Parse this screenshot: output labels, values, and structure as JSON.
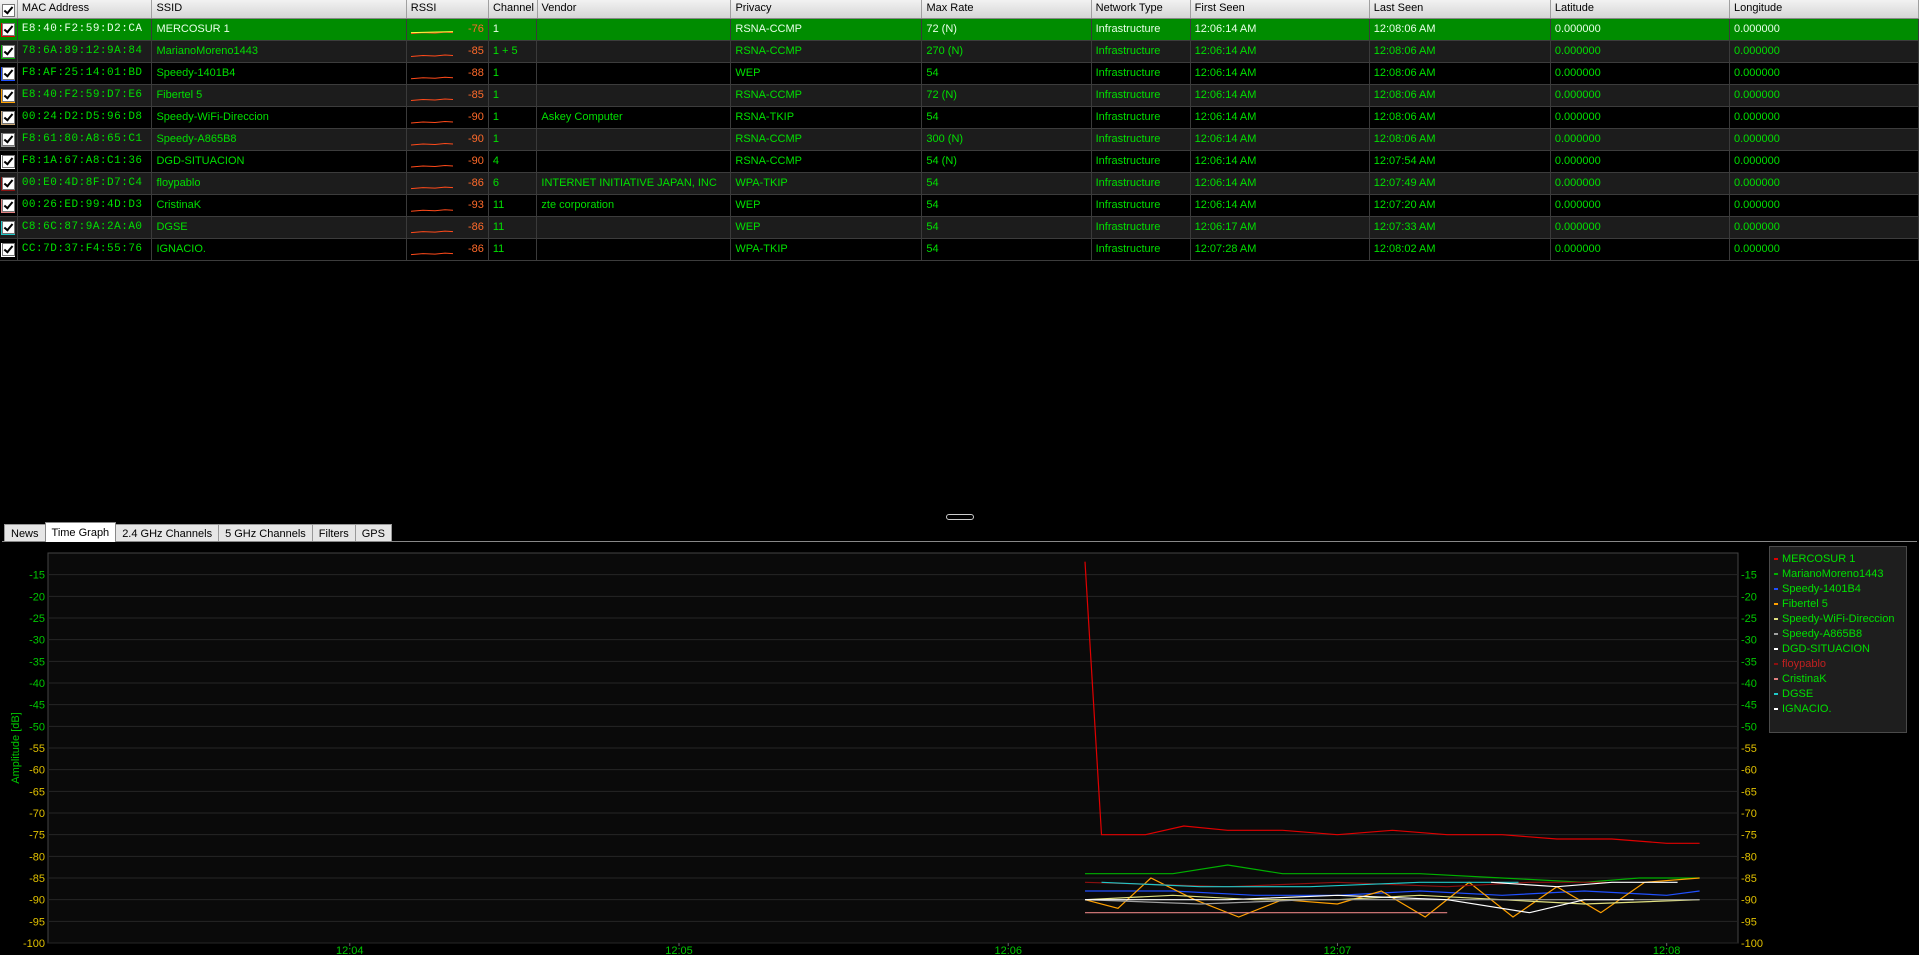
{
  "table": {
    "columns": [
      "MAC Address",
      "SSID",
      "RSSI",
      "Channel",
      "Vendor",
      "Privacy",
      "Max Rate",
      "Network Type",
      "First Seen",
      "Last Seen",
      "Latitude",
      "Longitude"
    ],
    "rows": [
      {
        "color": "#e00000",
        "mac": "E8:40:F2:59:D2:CA",
        "ssid": "MERCOSUR 1",
        "rssi": "-76",
        "channel": "1",
        "vendor": "",
        "privacy": "RSNA-CCMP",
        "max_rate": "72 (N)",
        "network_type": "Infrastructure",
        "first_seen": "12:06:14 AM",
        "last_seen": "12:08:06 AM",
        "latitude": "0.000000",
        "longitude": "0.000000",
        "selected": true
      },
      {
        "color": "#00b000",
        "mac": "78:6A:89:12:9A:84",
        "ssid": "MarianoMoreno1443",
        "rssi": "-85",
        "channel": "1 + 5",
        "vendor": "",
        "privacy": "RSNA-CCMP",
        "max_rate": "270 (N)",
        "network_type": "Infrastructure",
        "first_seen": "12:06:14 AM",
        "last_seen": "12:08:06 AM",
        "latitude": "0.000000",
        "longitude": "0.000000"
      },
      {
        "color": "#2050ff",
        "mac": "F8:AF:25:14:01:BD",
        "ssid": "Speedy-1401B4",
        "rssi": "-88",
        "channel": "1",
        "vendor": "",
        "privacy": "WEP",
        "max_rate": "54",
        "network_type": "Infrastructure",
        "first_seen": "12:06:14 AM",
        "last_seen": "12:08:06 AM",
        "latitude": "0.000000",
        "longitude": "0.000000"
      },
      {
        "color": "#ffa000",
        "mac": "E8:40:F2:59:D7:E6",
        "ssid": "Fibertel 5",
        "rssi": "-85",
        "channel": "1",
        "vendor": "",
        "privacy": "RSNA-CCMP",
        "max_rate": "72 (N)",
        "network_type": "Infrastructure",
        "first_seen": "12:06:14 AM",
        "last_seen": "12:08:06 AM",
        "latitude": "0.000000",
        "longitude": "0.000000"
      },
      {
        "color": "#c8a878",
        "mac": "00:24:D2:D5:96:D8",
        "ssid": "Speedy-WiFi-Direccion",
        "rssi": "-90",
        "channel": "1",
        "vendor": "Askey Computer",
        "privacy": "RSNA-TKIP",
        "max_rate": "54",
        "network_type": "Infrastructure",
        "first_seen": "12:06:14 AM",
        "last_seen": "12:08:06 AM",
        "latitude": "0.000000",
        "longitude": "0.000000"
      },
      {
        "color": "#a0a0a0",
        "mac": "F8:61:80:A8:65:C1",
        "ssid": "Speedy-A865B8",
        "rssi": "-90",
        "channel": "1",
        "vendor": "",
        "privacy": "RSNA-CCMP",
        "max_rate": "300 (N)",
        "network_type": "Infrastructure",
        "first_seen": "12:06:14 AM",
        "last_seen": "12:08:06 AM",
        "latitude": "0.000000",
        "longitude": "0.000000"
      },
      {
        "color": "#ffffff",
        "mac": "F8:1A:67:A8:C1:36",
        "ssid": "DGD-SITUACION",
        "rssi": "-90",
        "channel": "4",
        "vendor": "",
        "privacy": "RSNA-CCMP",
        "max_rate": "54 (N)",
        "network_type": "Infrastructure",
        "first_seen": "12:06:14 AM",
        "last_seen": "12:07:54 AM",
        "latitude": "0.000000",
        "longitude": "0.000000"
      },
      {
        "color": "#8b1010",
        "mac": "00:E0:4D:8F:D7:C4",
        "ssid": "floypablo",
        "rssi": "-86",
        "channel": "6",
        "vendor": "INTERNET INITIATIVE JAPAN, INC",
        "privacy": "WPA-TKIP",
        "max_rate": "54",
        "network_type": "Infrastructure",
        "first_seen": "12:06:14 AM",
        "last_seen": "12:07:49 AM",
        "latitude": "0.000000",
        "longitude": "0.000000"
      },
      {
        "color": "#e08080",
        "mac": "00:26:ED:99:4D:D3",
        "ssid": "CristinaK",
        "rssi": "-93",
        "channel": "11",
        "vendor": "zte corporation",
        "privacy": "WEP",
        "max_rate": "54",
        "network_type": "Infrastructure",
        "first_seen": "12:06:14 AM",
        "last_seen": "12:07:20 AM",
        "latitude": "0.000000",
        "longitude": "0.000000"
      },
      {
        "color": "#20c8c8",
        "mac": "C8:6C:87:9A:2A:A0",
        "ssid": "DGSE",
        "rssi": "-86",
        "channel": "11",
        "vendor": "",
        "privacy": "WEP",
        "max_rate": "54",
        "network_type": "Infrastructure",
        "first_seen": "12:06:17 AM",
        "last_seen": "12:07:33 AM",
        "latitude": "0.000000",
        "longitude": "0.000000"
      },
      {
        "color": "#ffffff",
        "mac": "CC:7D:37:F4:55:76",
        "ssid": "IGNACIO.",
        "rssi": "-86",
        "channel": "11",
        "vendor": "",
        "privacy": "WPA-TKIP",
        "max_rate": "54",
        "network_type": "Infrastructure",
        "first_seen": "12:07:28 AM",
        "last_seen": "12:08:02 AM",
        "latitude": "0.000000",
        "longitude": "0.000000"
      }
    ]
  },
  "tabs": [
    {
      "label": "News"
    },
    {
      "label": "Time Graph",
      "active": true
    },
    {
      "label": "2.4 GHz Channels"
    },
    {
      "label": "5 GHz Channels"
    },
    {
      "label": "Filters"
    },
    {
      "label": "GPS"
    }
  ],
  "chart_data": {
    "type": "line",
    "ylabel": "Amplitude [dB]",
    "ylim": [
      -100,
      -10
    ],
    "yticks": [
      -15,
      -20,
      -25,
      -30,
      -35,
      -40,
      -45,
      -50,
      -55,
      -60,
      -65,
      -70,
      -75,
      -80,
      -85,
      -90,
      -95,
      -100
    ],
    "xlim": [
      "12:03:05",
      "12:08:13"
    ],
    "xticks": [
      "12:04",
      "12:05",
      "12:06",
      "12:07",
      "12:08"
    ],
    "xtick_times": [
      "12:04:00",
      "12:05:00",
      "12:06:00",
      "12:07:00",
      "12:08:00"
    ],
    "legend_position": "top-right",
    "grid": true,
    "series": [
      {
        "name": "MERCOSUR 1",
        "color": "#e00000",
        "points": [
          [
            "12:06:14",
            -12
          ],
          [
            "12:06:17",
            -75
          ],
          [
            "12:06:25",
            -75
          ],
          [
            "12:06:32",
            -73
          ],
          [
            "12:06:40",
            -74
          ],
          [
            "12:06:50",
            -74
          ],
          [
            "12:07:00",
            -75
          ],
          [
            "12:07:10",
            -74
          ],
          [
            "12:07:20",
            -75
          ],
          [
            "12:07:30",
            -75
          ],
          [
            "12:07:40",
            -76
          ],
          [
            "12:07:50",
            -76
          ],
          [
            "12:08:00",
            -77
          ],
          [
            "12:08:06",
            -77
          ]
        ]
      },
      {
        "name": "MarianoMoreno1443",
        "color": "#00b000",
        "points": [
          [
            "12:06:14",
            -84
          ],
          [
            "12:06:30",
            -84
          ],
          [
            "12:06:40",
            -82
          ],
          [
            "12:06:50",
            -84
          ],
          [
            "12:07:00",
            -84
          ],
          [
            "12:07:15",
            -84
          ],
          [
            "12:07:30",
            -85
          ],
          [
            "12:07:45",
            -86
          ],
          [
            "12:07:55",
            -85
          ],
          [
            "12:08:06",
            -85
          ]
        ]
      },
      {
        "name": "Speedy-1401B4",
        "color": "#2050ff",
        "points": [
          [
            "12:06:14",
            -88
          ],
          [
            "12:06:30",
            -88
          ],
          [
            "12:06:45",
            -89
          ],
          [
            "12:07:00",
            -89
          ],
          [
            "12:07:15",
            -88
          ],
          [
            "12:07:30",
            -89
          ],
          [
            "12:07:45",
            -88
          ],
          [
            "12:08:00",
            -89
          ],
          [
            "12:08:06",
            -88
          ]
        ]
      },
      {
        "name": "Fibertel 5",
        "color": "#ffa000",
        "points": [
          [
            "12:06:14",
            -90
          ],
          [
            "12:06:20",
            -92
          ],
          [
            "12:06:26",
            -85
          ],
          [
            "12:06:34",
            -90
          ],
          [
            "12:06:42",
            -94
          ],
          [
            "12:06:50",
            -90
          ],
          [
            "12:07:00",
            -91
          ],
          [
            "12:07:08",
            -88
          ],
          [
            "12:07:16",
            -94
          ],
          [
            "12:07:24",
            -86
          ],
          [
            "12:07:32",
            -94
          ],
          [
            "12:07:40",
            -87
          ],
          [
            "12:07:48",
            -93
          ],
          [
            "12:07:56",
            -86
          ],
          [
            "12:08:06",
            -85
          ]
        ]
      },
      {
        "name": "Speedy-WiFi-Direccion",
        "color": "#e0e080",
        "points": [
          [
            "12:06:14",
            -90
          ],
          [
            "12:06:30",
            -89
          ],
          [
            "12:06:45",
            -90
          ],
          [
            "12:07:00",
            -90
          ],
          [
            "12:07:15",
            -89
          ],
          [
            "12:07:30",
            -90
          ],
          [
            "12:07:45",
            -91
          ],
          [
            "12:08:06",
            -90
          ]
        ]
      },
      {
        "name": "Speedy-A865B8",
        "color": "#a0a0a0",
        "points": [
          [
            "12:06:14",
            -90
          ],
          [
            "12:06:35",
            -91
          ],
          [
            "12:06:55",
            -90
          ],
          [
            "12:07:10",
            -90
          ],
          [
            "12:07:30",
            -90
          ],
          [
            "12:07:50",
            -90
          ],
          [
            "12:08:06",
            -90
          ]
        ]
      },
      {
        "name": "DGD-SITUACION",
        "color": "#ffffff",
        "points": [
          [
            "12:06:14",
            -90
          ],
          [
            "12:06:40",
            -90
          ],
          [
            "12:07:00",
            -89
          ],
          [
            "12:07:20",
            -90
          ],
          [
            "12:07:35",
            -93
          ],
          [
            "12:07:45",
            -90
          ],
          [
            "12:07:54",
            -90
          ]
        ]
      },
      {
        "name": "floypablo",
        "color": "#8b1010",
        "points": [
          [
            "12:06:14",
            -86
          ],
          [
            "12:06:40",
            -87
          ],
          [
            "12:07:00",
            -86
          ],
          [
            "12:07:20",
            -87
          ],
          [
            "12:07:35",
            -86
          ],
          [
            "12:07:49",
            -86
          ]
        ]
      },
      {
        "name": "CristinaK",
        "color": "#e08080",
        "points": [
          [
            "12:06:14",
            -93
          ],
          [
            "12:06:35",
            -93
          ],
          [
            "12:06:55",
            -93
          ],
          [
            "12:07:10",
            -93
          ],
          [
            "12:07:20",
            -93
          ]
        ]
      },
      {
        "name": "DGSE",
        "color": "#20c8c8",
        "points": [
          [
            "12:06:17",
            -86
          ],
          [
            "12:06:35",
            -87
          ],
          [
            "12:06:55",
            -87
          ],
          [
            "12:07:15",
            -86
          ],
          [
            "12:07:33",
            -86
          ]
        ]
      },
      {
        "name": "IGNACIO.",
        "color": "#ffffff",
        "points": [
          [
            "12:07:28",
            -86
          ],
          [
            "12:07:40",
            -87
          ],
          [
            "12:07:50",
            -86
          ],
          [
            "12:08:02",
            -86
          ]
        ]
      }
    ]
  }
}
